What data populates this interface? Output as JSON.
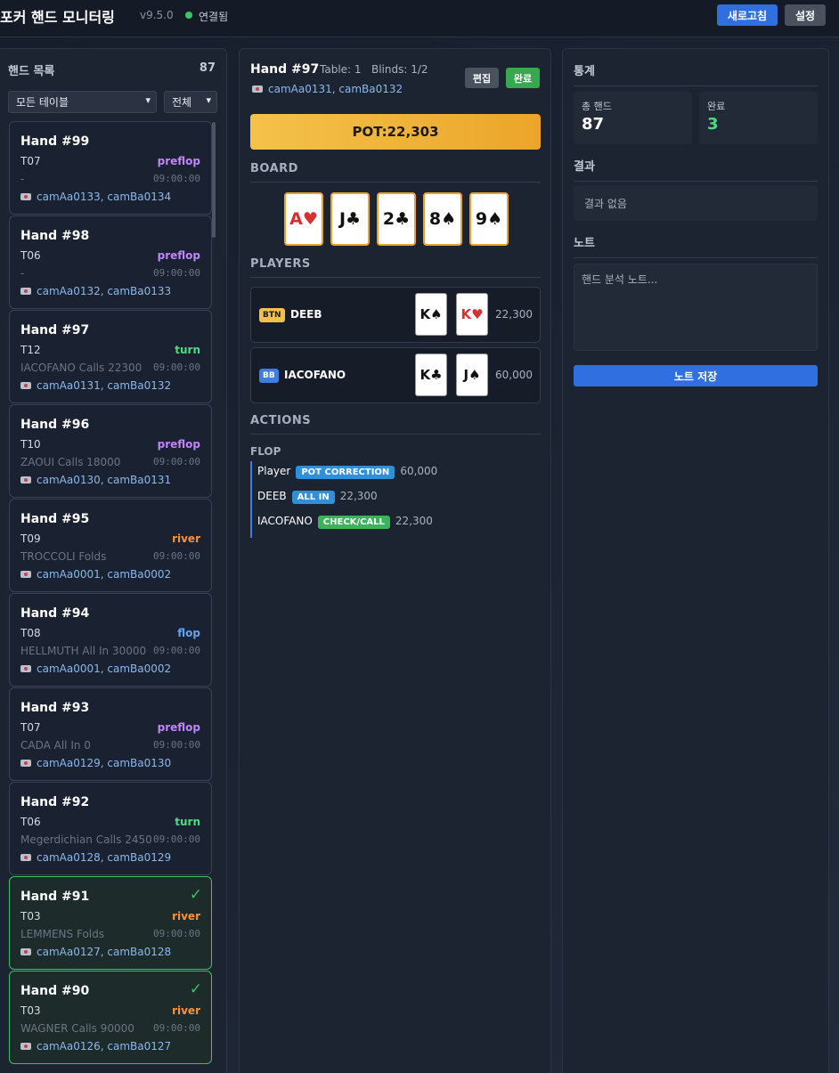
{
  "header": {
    "title": "포커 핸드 모니터링",
    "version": "v9.5.0",
    "status": "연결됨",
    "refresh_label": "새로고침",
    "settings_label": "설정"
  },
  "hand_list": {
    "title": "핸드 목록",
    "count": "87",
    "table_filter": "모든 테이블",
    "status_filter": "전체",
    "hands": [
      {
        "title": "Hand #99",
        "table": "T07",
        "street": "preflop",
        "last_action": "-",
        "time": "09:00:00",
        "cams": "camAa0133, camBa0134",
        "done": false
      },
      {
        "title": "Hand #98",
        "table": "T06",
        "street": "preflop",
        "last_action": "-",
        "time": "09:00:00",
        "cams": "camAa0132, camBa0133",
        "done": false
      },
      {
        "title": "Hand #97",
        "table": "T12",
        "street": "turn",
        "last_action": "IACOFANO Calls 22300",
        "time": "09:00:00",
        "cams": "camAa0131, camBa0132",
        "done": false
      },
      {
        "title": "Hand #96",
        "table": "T10",
        "street": "preflop",
        "last_action": "ZAOUI Calls 18000",
        "time": "09:00:00",
        "cams": "camAa0130, camBa0131",
        "done": false
      },
      {
        "title": "Hand #95",
        "table": "T09",
        "street": "river",
        "last_action": "TROCCOLI Folds",
        "time": "09:00:00",
        "cams": "camAa0001, camBa0002",
        "done": false
      },
      {
        "title": "Hand #94",
        "table": "T08",
        "street": "flop",
        "last_action": "HELLMUTH All In 30000",
        "time": "09:00:00",
        "cams": "camAa0001, camBa0002",
        "done": false
      },
      {
        "title": "Hand #93",
        "table": "T07",
        "street": "preflop",
        "last_action": "CADA All In 0",
        "time": "09:00:00",
        "cams": "camAa0129, camBa0130",
        "done": false
      },
      {
        "title": "Hand #92",
        "table": "T06",
        "street": "turn",
        "last_action": "Megerdichian Calls 2450",
        "time": "09:00:00",
        "cams": "camAa0128, camBa0129",
        "done": false
      },
      {
        "title": "Hand #91",
        "table": "T03",
        "street": "river",
        "last_action": "LEMMENS Folds",
        "time": "09:00:00",
        "cams": "camAa0127, camBa0128",
        "done": true
      },
      {
        "title": "Hand #90",
        "table": "T03",
        "street": "river",
        "last_action": "WAGNER Calls 90000",
        "time": "09:00:00",
        "cams": "camAa0126, camBa0127",
        "done": true
      }
    ],
    "check_mark": "✓",
    "street_colors": {
      "preflop": "#c084fc",
      "turn": "#4ade80",
      "river": "#fb923c",
      "flop": "#60a5fa"
    }
  },
  "detail": {
    "hand": "Hand #97",
    "meta": "Table: 1   Blinds: 1/2",
    "cams": "camAa0131, camBa0132",
    "edit_label": "편집",
    "done_label": "완료",
    "pot": "POT:22,303",
    "board_title": "BOARD",
    "board": [
      {
        "rank": "A",
        "suit": "♥",
        "color": "red"
      },
      {
        "rank": "J",
        "suit": "♣",
        "color": "black"
      },
      {
        "rank": "2",
        "suit": "♣",
        "color": "black"
      },
      {
        "rank": "8",
        "suit": "♠",
        "color": "black"
      },
      {
        "rank": "9",
        "suit": "♠",
        "color": "black"
      }
    ],
    "players_title": "PLAYERS",
    "players": [
      {
        "position": "BTN",
        "name": "DEEB",
        "stack": "22,300",
        "cards": [
          {
            "rank": "K",
            "suit": "♠",
            "color": "black"
          },
          {
            "rank": "K",
            "suit": "♥",
            "color": "red"
          }
        ]
      },
      {
        "position": "BB",
        "name": "IACOFANO",
        "stack": "60,000",
        "cards": [
          {
            "rank": "K",
            "suit": "♣",
            "color": "black"
          },
          {
            "rank": "J",
            "suit": "♠",
            "color": "black"
          }
        ]
      }
    ],
    "actions_title": "ACTIONS",
    "street": "FLOP",
    "actions": [
      {
        "who": "Player",
        "tag": "POT CORRECTION",
        "amount": "60,000",
        "color": "#2f8fd8"
      },
      {
        "who": "DEEB",
        "tag": "ALL IN",
        "amount": "22,300",
        "color": "#2f8fd8"
      },
      {
        "who": "IACOFANO",
        "tag": "CHECK/CALL",
        "amount": "22,300",
        "color": "#3cb35a"
      }
    ]
  },
  "stats": {
    "title": "통계",
    "total_label": "총 핸드",
    "total_value": "87",
    "done_label": "완료",
    "done_value": "3",
    "result_title": "결과",
    "result_text": "결과 없음",
    "note_title": "노트",
    "note_placeholder": "핸드 분석 노트...",
    "save_label": "노트 저장"
  }
}
